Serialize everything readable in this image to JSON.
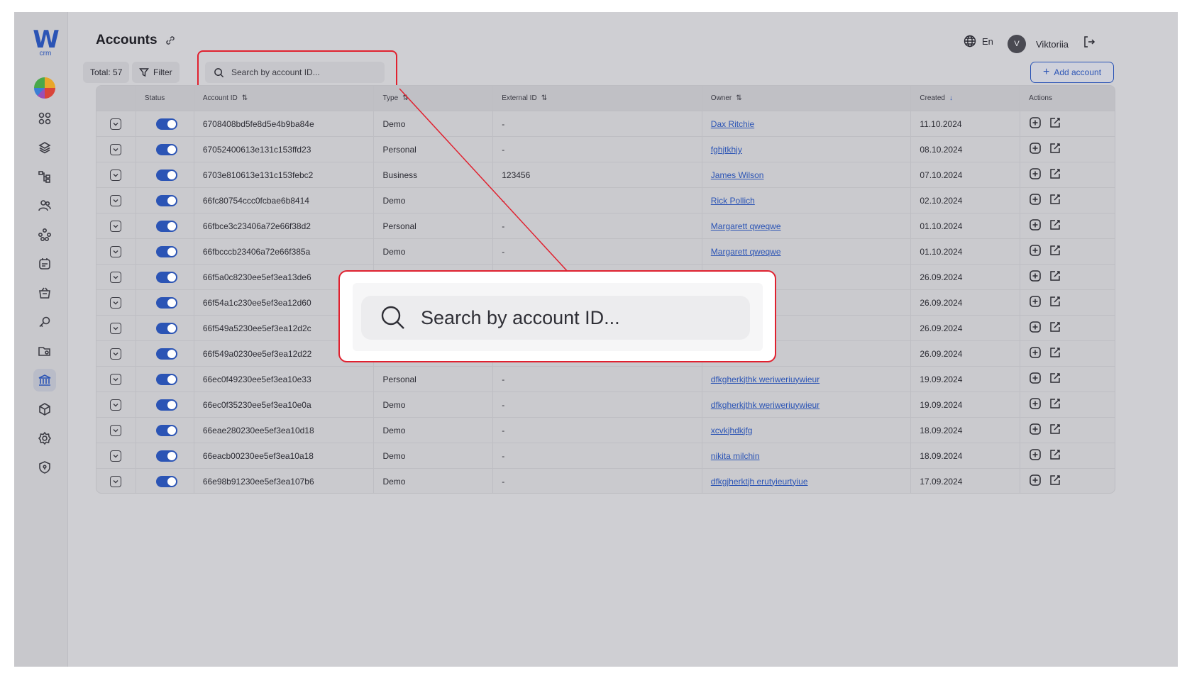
{
  "app": {
    "logo_text": "W",
    "logo_sub": "crm"
  },
  "header": {
    "title": "Accounts",
    "total": "Total: 57",
    "filter": "Filter",
    "search_placeholder": "Search by account ID...",
    "language": "En",
    "user_initial": "V",
    "user_name": "Viktoriia",
    "add_account": "Add account"
  },
  "table": {
    "columns": [
      "Status",
      "Account ID",
      "Type",
      "External ID",
      "Owner",
      "Created",
      "Actions"
    ],
    "rows": [
      {
        "id": "6708408bd5fe8d5e4b9ba84e",
        "type": "Demo",
        "ext": "-",
        "owner": "Dax Ritchie",
        "created": "11.10.2024"
      },
      {
        "id": "67052400613e131c153ffd23",
        "type": "Personal",
        "ext": "-",
        "owner": "fghjtkhjy",
        "created": "08.10.2024"
      },
      {
        "id": "6703e810613e131c153febc2",
        "type": "Business",
        "ext": "123456",
        "owner": "James Wilson",
        "created": "07.10.2024"
      },
      {
        "id": "66fc80754ccc0fcbae6b8414",
        "type": "Demo",
        "ext": "-",
        "owner": "Rick Pollich",
        "created": "02.10.2024"
      },
      {
        "id": "66fbce3c23406a72e66f38d2",
        "type": "Personal",
        "ext": "-",
        "owner": "Margarett qweqwe",
        "created": "01.10.2024"
      },
      {
        "id": "66fbcccb23406a72e66f385a",
        "type": "Demo",
        "ext": "-",
        "owner": "Margarett qweqwe",
        "created": "01.10.2024"
      },
      {
        "id": "66f5a0c8230ee5ef3ea13de6",
        "type": "",
        "ext": "",
        "owner": "",
        "created": "26.09.2024"
      },
      {
        "id": "66f54a1c230ee5ef3ea12d60",
        "type": "",
        "ext": "",
        "owner": "",
        "created": "26.09.2024"
      },
      {
        "id": "66f549a5230ee5ef3ea12d2c",
        "type": "",
        "ext": "",
        "owner": "",
        "created": "26.09.2024"
      },
      {
        "id": "66f549a0230ee5ef3ea12d22",
        "type": "",
        "ext": "",
        "owner": "",
        "created": "26.09.2024"
      },
      {
        "id": "66ec0f49230ee5ef3ea10e33",
        "type": "Personal",
        "ext": "-",
        "owner": "dfkgherkjthk weriweriuywieur",
        "created": "19.09.2024"
      },
      {
        "id": "66ec0f35230ee5ef3ea10e0a",
        "type": "Demo",
        "ext": "-",
        "owner": "dfkgherkjthk weriweriuywieur",
        "created": "19.09.2024"
      },
      {
        "id": "66eae280230ee5ef3ea10d18",
        "type": "Demo",
        "ext": "-",
        "owner": "xcvkjhdkjfg",
        "created": "18.09.2024"
      },
      {
        "id": "66eacb00230ee5ef3ea10a18",
        "type": "Demo",
        "ext": "-",
        "owner": "nikita milchin",
        "created": "18.09.2024"
      },
      {
        "id": "66e98b91230ee5ef3ea107b6",
        "type": "Demo",
        "ext": "-",
        "owner": "dfkgjherktjh erutyieurtyiue",
        "created": "17.09.2024"
      }
    ]
  },
  "zoom": {
    "placeholder": "Search by account ID..."
  },
  "colors": {
    "accent": "#2b54b5",
    "highlight": "#e0212f"
  }
}
